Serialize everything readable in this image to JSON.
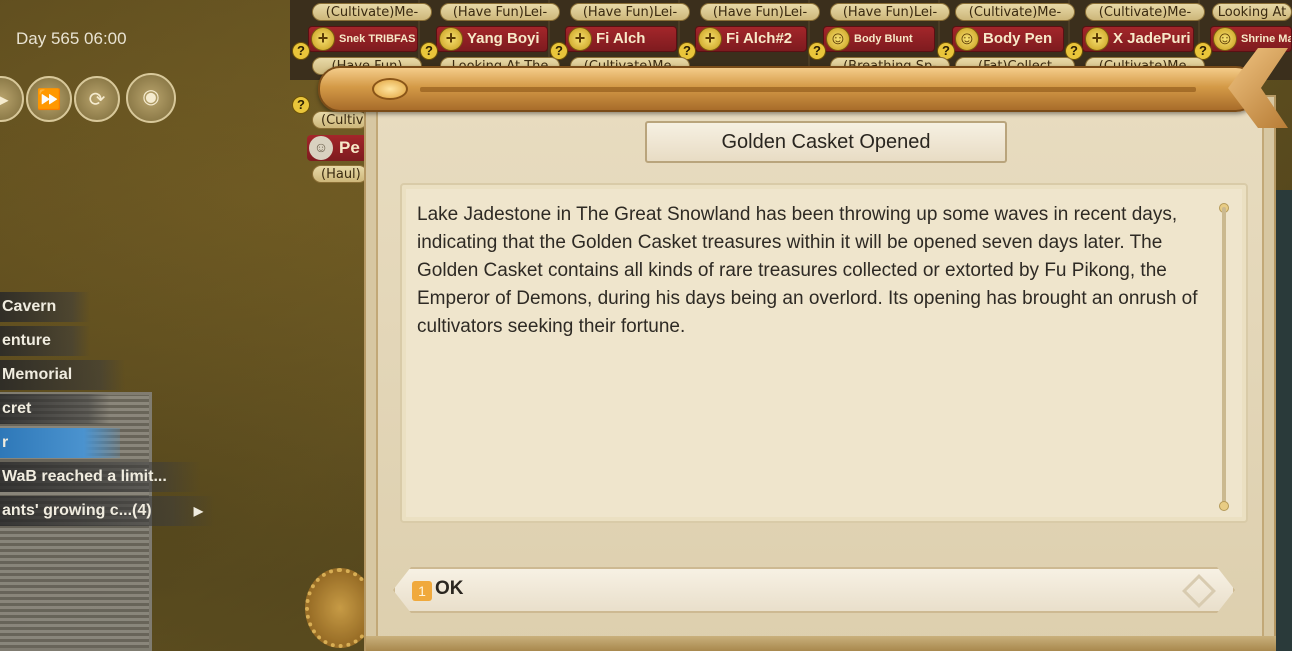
{
  "hud": {
    "day_time": "Day 565 06:00",
    "controls": [
      "play-icon",
      "fast-forward-icon",
      "speed-icon",
      "palette-icon"
    ]
  },
  "roster": {
    "top_tags": [
      "(Cultivate)Me-",
      "(Have Fun)Lei-",
      "(Have Fun)Lei-",
      "(Have Fun)Lei-",
      "(Have Fun)Lei-",
      "(Cultivate)Me-",
      "(Cultivate)Me-",
      "Looking At"
    ],
    "characters": [
      {
        "name": "Snek TRIBFAS",
        "small": true
      },
      {
        "name": "Yang Boyi",
        "small": false
      },
      {
        "name": "Fi Alch",
        "small": false
      },
      {
        "name": "Fi Alch#2",
        "small": false
      },
      {
        "name": "Body Blunt",
        "small": true
      },
      {
        "name": "Body Pen",
        "small": false
      },
      {
        "name": "X JadePuri",
        "small": false
      },
      {
        "name": "Shrine Ma",
        "small": true
      }
    ],
    "bottom_tags": [
      "(Have Fun)",
      "Looking At The",
      "(Cultivate)Me-",
      "",
      "(Breathing Sp-",
      "(Fat)Collect",
      "(Cultivate)Me-",
      ""
    ],
    "left_tags": [
      "(Cultiv",
      "(Haul)"
    ],
    "left_char": "Pe"
  },
  "notices": [
    {
      "label": "Cavern",
      "style": "dark"
    },
    {
      "label": "enture",
      "style": "dark"
    },
    {
      "label": "Memorial",
      "style": "dark"
    },
    {
      "label": "cret",
      "style": "dark"
    },
    {
      "label": "r",
      "style": "blue"
    },
    {
      "label": "WaB reached a limit...",
      "style": "dark"
    },
    {
      "label": "ants' growing c...(4)",
      "style": "dark",
      "arrow": "▶"
    }
  ],
  "dialog": {
    "title": "Golden Casket Opened",
    "body": "Lake Jadestone in The Great Snowland has been throwing up some waves in recent days, indicating that the Golden Casket treasures within it will be opened seven days later. The Golden Casket contains all kinds of rare treasures collected or extorted by Fu Pikong, the Emperor of Demons, during his days being an overlord. Its opening has brought an onrush of cultivators seeking their fortune.",
    "ok_key": "1",
    "ok_label": "OK"
  },
  "colors": {
    "accent": "#d49a47",
    "character_bar": "#a3262a",
    "notice_blue": "#2e78b8",
    "ok_key": "#f0a93c"
  }
}
